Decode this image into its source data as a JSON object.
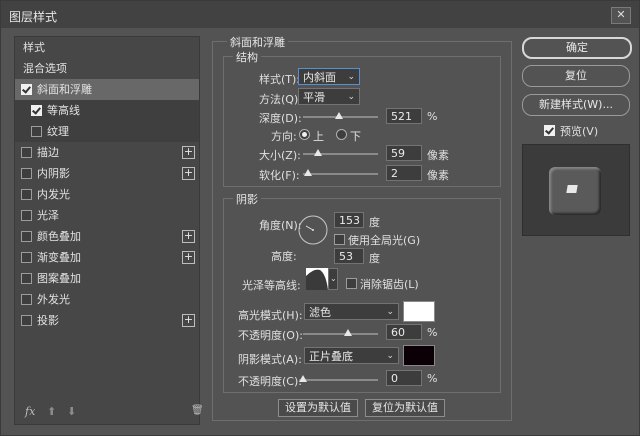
{
  "window": {
    "title": "图层样式",
    "close_glyph": "✕"
  },
  "sidebar": {
    "items": [
      {
        "label": "样式"
      },
      {
        "label": "混合选项"
      },
      {
        "label": "斜面和浮雕",
        "checked": true
      },
      {
        "label": "等高线",
        "checked": true
      },
      {
        "label": "纹理",
        "checked": false
      },
      {
        "label": "描边",
        "checked": false,
        "plus": "+"
      },
      {
        "label": "内阴影",
        "checked": false,
        "plus": "+"
      },
      {
        "label": "内发光",
        "checked": false
      },
      {
        "label": "光泽",
        "checked": false
      },
      {
        "label": "颜色叠加",
        "checked": false,
        "plus": "+"
      },
      {
        "label": "渐变叠加",
        "checked": false,
        "plus": "+"
      },
      {
        "label": "图案叠加",
        "checked": false
      },
      {
        "label": "外发光",
        "checked": false
      },
      {
        "label": "投影",
        "checked": false,
        "plus": "+"
      }
    ],
    "footer": {
      "fx": "fx",
      "up": "⬆",
      "down": "⬇",
      "trash": "🗑"
    }
  },
  "bevel": {
    "title": "斜面和浮雕",
    "structure": {
      "title": "结构",
      "style_label": "样式(T):",
      "style_value": "内斜面",
      "method_label": "方法(Q):",
      "method_value": "平滑",
      "depth_label": "深度(D):",
      "depth_value": "521",
      "depth_unit": "%",
      "depth_pct": 0.48,
      "direction_label": "方向:",
      "dir_up": "上",
      "dir_down": "下",
      "size_label": "大小(Z):",
      "size_value": "59",
      "size_unit": "像素",
      "size_pct": 0.2,
      "soften_label": "软化(F):",
      "soften_value": "2",
      "soften_unit": "像素",
      "soften_pct": 0.07
    },
    "shading": {
      "title": "阴影",
      "angle_label": "角度(N):",
      "angle_value": "153",
      "angle_unit": "度",
      "global_light_label": "使用全局光(G)",
      "altitude_label": "高度:",
      "altitude_value": "53",
      "altitude_unit": "度",
      "gloss_label": "光泽等高线:",
      "antialias_label": "消除锯齿(L)",
      "highlight_mode_label": "高光模式(H):",
      "highlight_mode_value": "滤色",
      "highlight_color": "#ffffff",
      "highlight_opacity_label": "不透明度(O):",
      "highlight_opacity_value": "60",
      "opacity_unit": "%",
      "highlight_pct": 0.6,
      "shadow_mode_label": "阴影模式(A):",
      "shadow_mode_value": "正片叠底",
      "shadow_color": "#0a0005",
      "shadow_opacity_label": "不透明度(C):",
      "shadow_opacity_value": "0",
      "shadow_pct": 0.0
    },
    "make_default": "设置为默认值",
    "reset_default": "复位为默认值"
  },
  "buttons": {
    "ok": "确定",
    "reset": "复位",
    "new_style": "新建样式(W)...",
    "preview_label": "预览(V)",
    "preview_checked": true
  }
}
